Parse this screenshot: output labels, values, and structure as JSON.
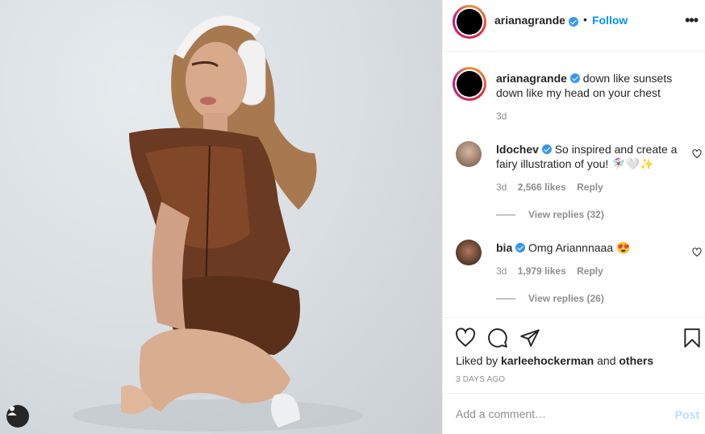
{
  "header": {
    "username": "arianagrande",
    "separator": "•",
    "follow_label": "Follow",
    "more_label": "•••"
  },
  "caption": {
    "username": "arianagrande",
    "text": "down like sunsets down like my head on your chest",
    "time": "3d"
  },
  "comments": [
    {
      "username": "ldochev",
      "text": "So inspired and create a fairy illustration of you! 🧚🏻‍♀️🤍✨",
      "time": "3d",
      "likes": "2,566 likes",
      "reply_label": "Reply",
      "view_replies": "View replies (32)"
    },
    {
      "username": "bia",
      "text": "Omg Ariannnaaa 😍",
      "time": "3d",
      "likes": "1,979 likes",
      "reply_label": "Reply",
      "view_replies": "View replies (26)"
    }
  ],
  "likes": {
    "prefix": "Liked by",
    "user": "karleehockerman",
    "and": "and",
    "others": "others"
  },
  "time_ago": "3 DAYS AGO",
  "comment_input": {
    "placeholder": "Add a comment…",
    "post_label": "Post"
  },
  "icons": {
    "like": "heart-icon",
    "comment": "comment-icon",
    "share": "paper-plane-icon",
    "save": "bookmark-icon",
    "tag": "user-tag-icon"
  },
  "colors": {
    "accent": "#0095f6",
    "verified": "#3897f0",
    "muted": "#8e8e8e",
    "post_disabled": "#b2dffc"
  }
}
